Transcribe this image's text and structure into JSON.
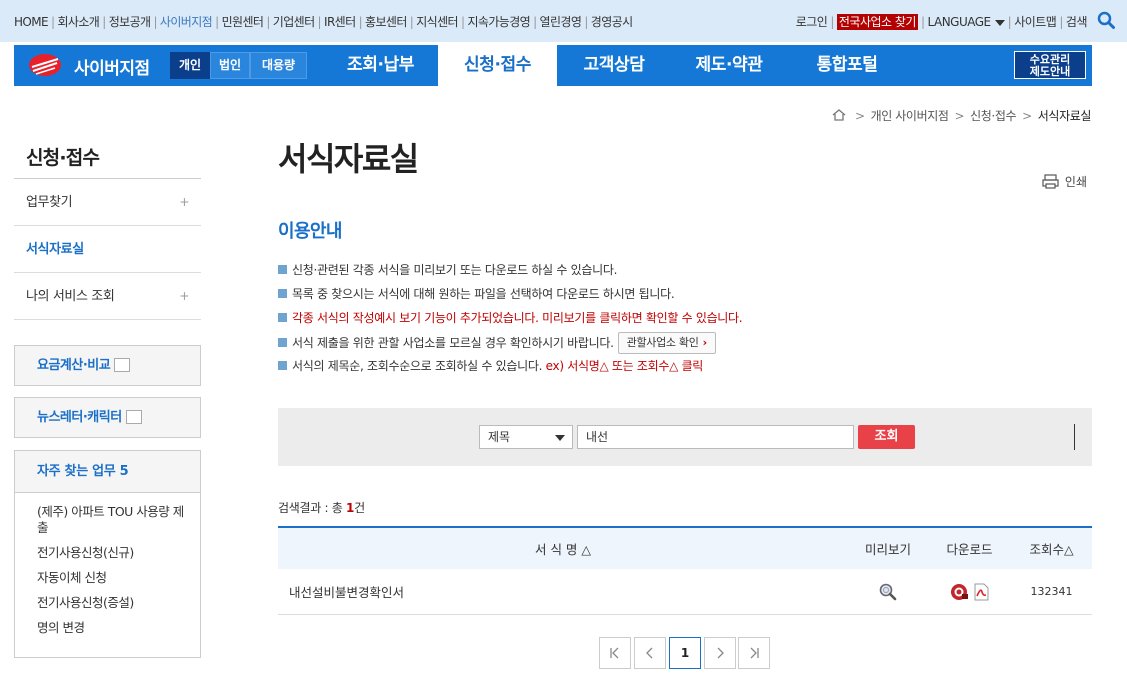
{
  "util": {
    "left": [
      "HOME",
      "회사소개",
      "정보공개",
      "사이버지점",
      "민원센터",
      "기업센터",
      "IR센터",
      "홍보센터",
      "지식센터",
      "지속가능경영",
      "열린경영",
      "경영공시"
    ],
    "login": "로그인",
    "office_find": "전국사업소 찾기",
    "language": "LANGUAGE",
    "sitemap": "사이트맵",
    "search": "검색"
  },
  "gnb": {
    "brand": "사이버지점",
    "segments": [
      "개인",
      "법인",
      "대용량"
    ],
    "menus": [
      "조회·납부",
      "신청·접수",
      "고객상담",
      "제도·약관",
      "통합포털"
    ],
    "side_btn_1": "수요관리",
    "side_btn_2": "제도안내"
  },
  "breadcrumb": [
    "개인 사이버지점",
    "신청·접수",
    "서식자료실"
  ],
  "sidebar": {
    "title": "신청·접수",
    "items": [
      "업무찾기",
      "서식자료실",
      "나의 서비스 조회"
    ],
    "box1": "요금계산·비교",
    "box2": "뉴스레터·캐릭터",
    "fav_title": "자주 찾는 업무 5",
    "fav_items": [
      "(제주) 아파트 TOU 사용량 제출",
      "전기사용신청(신규)",
      "자동이체 신청",
      "전기사용신청(증설)",
      "명의 변경"
    ]
  },
  "main": {
    "title": "서식자료실",
    "print": "인쇄",
    "subtitle": "이용안내",
    "guide": [
      "신청·관련된 각종 서식을 미리보기 또는 다운로드 하실 수 있습니다.",
      "목록 중 찾으시는 서식에 대해 원하는 파일을 선택하여 다운로드 하시면 됩니다.",
      "각종 서식의 작성예시 보기 기능이 추가되었습니다. 미리보기를 클릭하면 확인할 수 있습니다.",
      "서식 제출을 위한 관할 사업소를 모르실 경우 확인하시기 바랍니다.",
      "서식의 제목순, 조회수순으로 조회하실 수 있습니다."
    ],
    "guide_btn": "관할사업소 확인",
    "guide_example": "ex) 서식명△ 또는 조회수△ 클릭",
    "search": {
      "select": "제목",
      "value": "내선",
      "button": "조회"
    },
    "result_prefix": "검색결과 : 총",
    "result_count": "1",
    "result_suffix": "건",
    "table": {
      "headers": [
        "서 식 명 △",
        "미리보기",
        "다운로드",
        "조회수△"
      ],
      "rows": [
        {
          "name": "내선설비불변경확인서",
          "views": "132341"
        }
      ]
    },
    "pager": {
      "current": "1"
    }
  }
}
